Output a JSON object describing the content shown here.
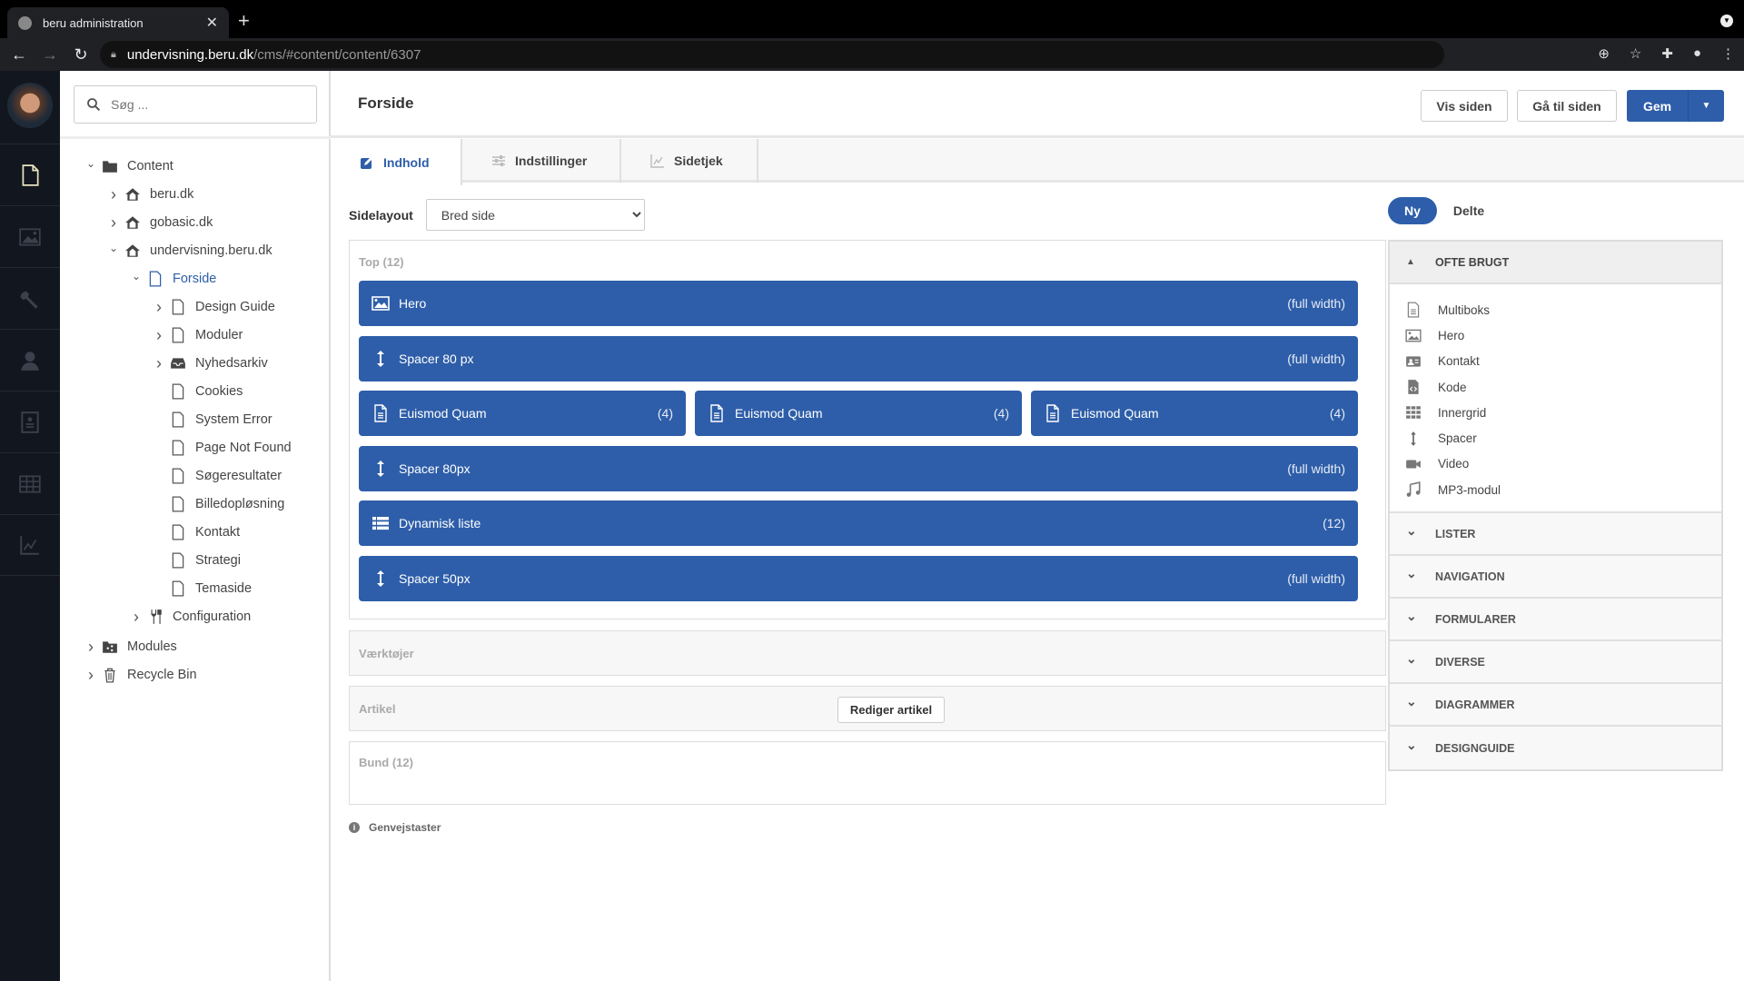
{
  "browser": {
    "tab_title": "beru administration",
    "url_host": "undervisning.beru.dk",
    "url_path": "/cms/#content/content/6307"
  },
  "rail": {
    "items": [
      {
        "icon": "document-icon",
        "active": true
      },
      {
        "icon": "image-icon",
        "active": false
      },
      {
        "icon": "wrench-icon",
        "active": false
      },
      {
        "icon": "user-icon",
        "active": false
      },
      {
        "icon": "contact-card-icon",
        "active": false
      },
      {
        "icon": "table-icon",
        "active": false
      },
      {
        "icon": "chart-icon",
        "active": false
      }
    ]
  },
  "tree": {
    "search_placeholder": "Søg ...",
    "nodes": [
      {
        "label": "Content",
        "level": 0,
        "chevron": "down",
        "icon": "folder-icon"
      },
      {
        "label": "beru.dk",
        "level": 1,
        "chevron": "right",
        "icon": "home-icon"
      },
      {
        "label": "gobasic.dk",
        "level": 1,
        "chevron": "right",
        "icon": "home-icon"
      },
      {
        "label": "undervisning.beru.dk",
        "level": 1,
        "chevron": "down",
        "icon": "home-icon"
      },
      {
        "label": "Forside",
        "level": 2,
        "chevron": "down",
        "icon": "page-icon",
        "active": true
      },
      {
        "label": "Design Guide",
        "level": 3,
        "chevron": "right",
        "icon": "page-icon"
      },
      {
        "label": "Moduler",
        "level": 3,
        "chevron": "right",
        "icon": "page-icon"
      },
      {
        "label": "Nyhedsarkiv",
        "level": 3,
        "chevron": "right",
        "icon": "inbox-icon"
      },
      {
        "label": "Cookies",
        "level": 3,
        "chevron": "",
        "icon": "page-icon"
      },
      {
        "label": "System Error",
        "level": 3,
        "chevron": "",
        "icon": "page-icon"
      },
      {
        "label": "Page Not Found",
        "level": 3,
        "chevron": "",
        "icon": "page-icon"
      },
      {
        "label": "Søgeresultater",
        "level": 3,
        "chevron": "",
        "icon": "page-icon"
      },
      {
        "label": "Billedopløsning",
        "level": 3,
        "chevron": "",
        "icon": "page-icon"
      },
      {
        "label": "Kontakt",
        "level": 3,
        "chevron": "",
        "icon": "page-icon"
      },
      {
        "label": "Strategi",
        "level": 3,
        "chevron": "",
        "icon": "page-icon"
      },
      {
        "label": "Temaside",
        "level": 3,
        "chevron": "",
        "icon": "page-icon"
      },
      {
        "label": "Configuration",
        "level": 2,
        "chevron": "right",
        "icon": "configuration-icon"
      },
      {
        "label": "Modules",
        "level": 0,
        "chevron": "right",
        "icon": "shared-folder-icon"
      },
      {
        "label": "Recycle Bin",
        "level": 0,
        "chevron": "right",
        "icon": "trash-icon"
      }
    ]
  },
  "header": {
    "title": "Forside",
    "vis_siden": "Vis siden",
    "gaa_til_siden": "Gå til siden",
    "gem": "Gem"
  },
  "tabs": [
    {
      "label": "Indhold",
      "icon": "edit-icon",
      "active": true
    },
    {
      "label": "Indstillinger",
      "icon": "sliders-icon",
      "active": false
    },
    {
      "label": "Sidetjek",
      "icon": "chart-icon",
      "active": false
    }
  ],
  "layout": {
    "label": "Sidelayout",
    "selected": "Bred side"
  },
  "zones": {
    "top": {
      "label": "Top (12)",
      "blocks": [
        {
          "name": "Hero",
          "meta": "(full width)",
          "icon": "image-icon"
        },
        {
          "name": "Spacer 80 px",
          "meta": "(full width)",
          "icon": "spacer-icon"
        },
        {
          "name": "Euismod Quam",
          "meta": "(4)",
          "icon": "document-icon"
        },
        {
          "name": "Euismod Quam",
          "meta": "(4)",
          "icon": "document-icon"
        },
        {
          "name": "Euismod Quam",
          "meta": "(4)",
          "icon": "document-icon"
        },
        {
          "name": "Spacer 80px",
          "meta": "(full width)",
          "icon": "spacer-icon"
        },
        {
          "name": "Dynamisk liste",
          "meta": "(12)",
          "icon": "list-icon"
        },
        {
          "name": "Spacer 50px",
          "meta": "(full width)",
          "icon": "spacer-icon"
        }
      ]
    },
    "vaerktoejer": {
      "label": "Værktøjer"
    },
    "artikel": {
      "label": "Artikel",
      "button": "Rediger artikel"
    },
    "bund": {
      "label": "Bund (12)"
    }
  },
  "shortcuts": "Genvejstaster",
  "palette": {
    "pills": [
      {
        "label": "Ny",
        "active": true
      },
      {
        "label": "Delte",
        "active": false
      }
    ],
    "open_section": {
      "title": "OFTE BRUGT",
      "items": [
        {
          "label": "Multiboks",
          "icon": "document-icon"
        },
        {
          "label": "Hero",
          "icon": "image-icon"
        },
        {
          "label": "Kontakt",
          "icon": "contact-card-icon"
        },
        {
          "label": "Kode",
          "icon": "code-file-icon"
        },
        {
          "label": "Innergrid",
          "icon": "grid-icon"
        },
        {
          "label": "Spacer",
          "icon": "spacer-icon"
        },
        {
          "label": "Video",
          "icon": "video-icon"
        },
        {
          "label": "MP3-modul",
          "icon": "music-icon"
        }
      ]
    },
    "closed_sections": [
      "LISTER",
      "NAVIGATION",
      "FORMULARER",
      "DIVERSE",
      "DIAGRAMMER",
      "DESIGNGUIDE"
    ]
  },
  "colors": {
    "accent": "#2e5ea9",
    "rail_bg": "#12161e"
  }
}
